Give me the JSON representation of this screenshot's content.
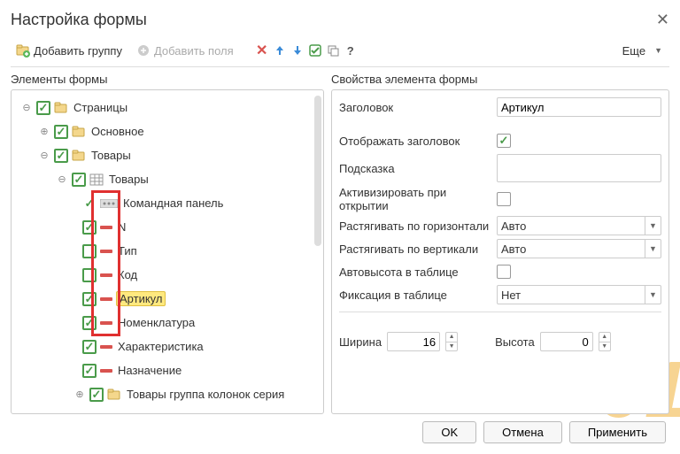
{
  "window": {
    "title": "Настройка формы"
  },
  "toolbar": {
    "add_group": "Добавить группу",
    "add_fields": "Добавить поля",
    "more": "Еще"
  },
  "panels": {
    "left_title": "Элементы формы",
    "right_title": "Свойства элемента формы"
  },
  "tree": {
    "pages": "Страницы",
    "main": "Основное",
    "goods": "Товары",
    "goods_table": "Товары",
    "cmd_panel": "Командная панель",
    "n": "N",
    "type": "Тип",
    "code": "Код",
    "article": "Артикул",
    "nomenclature": "Номенклатура",
    "characteristic": "Характеристика",
    "purpose": "Назначение",
    "goods_group": "Товары группа колонок серия"
  },
  "props": {
    "header_label": "Заголовок",
    "header_value": "Артикул",
    "show_header_label": "Отображать заголовок",
    "hint_label": "Подсказка",
    "hint_value": "",
    "activate_label": "Активизировать при открытии",
    "stretch_h_label": "Растягивать по горизонтали",
    "stretch_h_value": "Авто",
    "stretch_v_label": "Растягивать по вертикали",
    "stretch_v_value": "Авто",
    "autoheight_label": "Автовысота в таблице",
    "fixation_label": "Фиксация в таблице",
    "fixation_value": "Нет",
    "width_label": "Ширина",
    "width_value": "16",
    "height_label": "Высота",
    "height_value": "0"
  },
  "footer": {
    "ok": "OK",
    "cancel": "Отмена",
    "apply": "Применить"
  }
}
